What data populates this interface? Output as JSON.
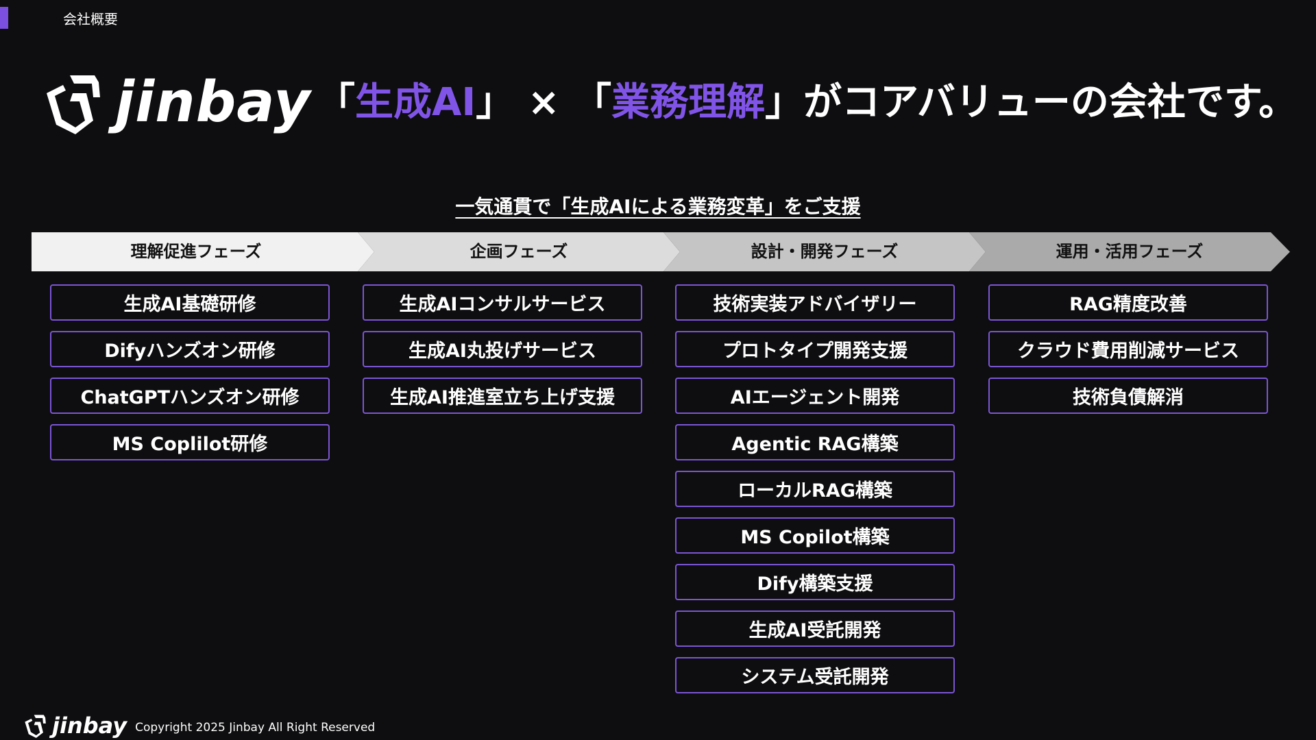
{
  "header": {
    "section_label": "会社概要"
  },
  "brand": {
    "logo_text": "jinbay"
  },
  "headline": {
    "open1": "「",
    "highlight1": "生成AI",
    "close1": "」",
    "times": "×",
    "open2": "「",
    "highlight2": "業務理解",
    "close2": "」",
    "rest": "がコアバリューの会社です。"
  },
  "subtitle": "一気通貫で「生成AIによる業務変革」をご支援",
  "phases": [
    {
      "label": "理解促進フェーズ",
      "items": [
        "生成AI基礎研修",
        "Difyハンズオン研修",
        "ChatGPTハンズオン研修",
        "MS Coplilot研修"
      ]
    },
    {
      "label": "企画フェーズ",
      "items": [
        "生成AIコンサルサービス",
        "生成AI丸投げサービス",
        "生成AI推進室立ち上げ支援"
      ]
    },
    {
      "label": "設計・開発フェーズ",
      "items": [
        "技術実装アドバイザリー",
        "プロトタイプ開発支援",
        "AIエージェント開発",
        "Agentic RAG構築",
        "ローカルRAG構築",
        "MS Copilot構築",
        "Dify構築支援",
        "生成AI受託開発",
        "システム受託開発"
      ]
    },
    {
      "label": "運用・活用フェーズ",
      "items": [
        "RAG精度改善",
        "クラウド費用削減サービス",
        "技術負債解消"
      ]
    }
  ],
  "footer": {
    "logo_text": "jinbay",
    "copyright": "Copyright 2025 Jinbay All Right Reserved"
  },
  "colors": {
    "accent": "#7b4fe0",
    "card_border": "#7c55d6",
    "background": "#0e0e10"
  }
}
